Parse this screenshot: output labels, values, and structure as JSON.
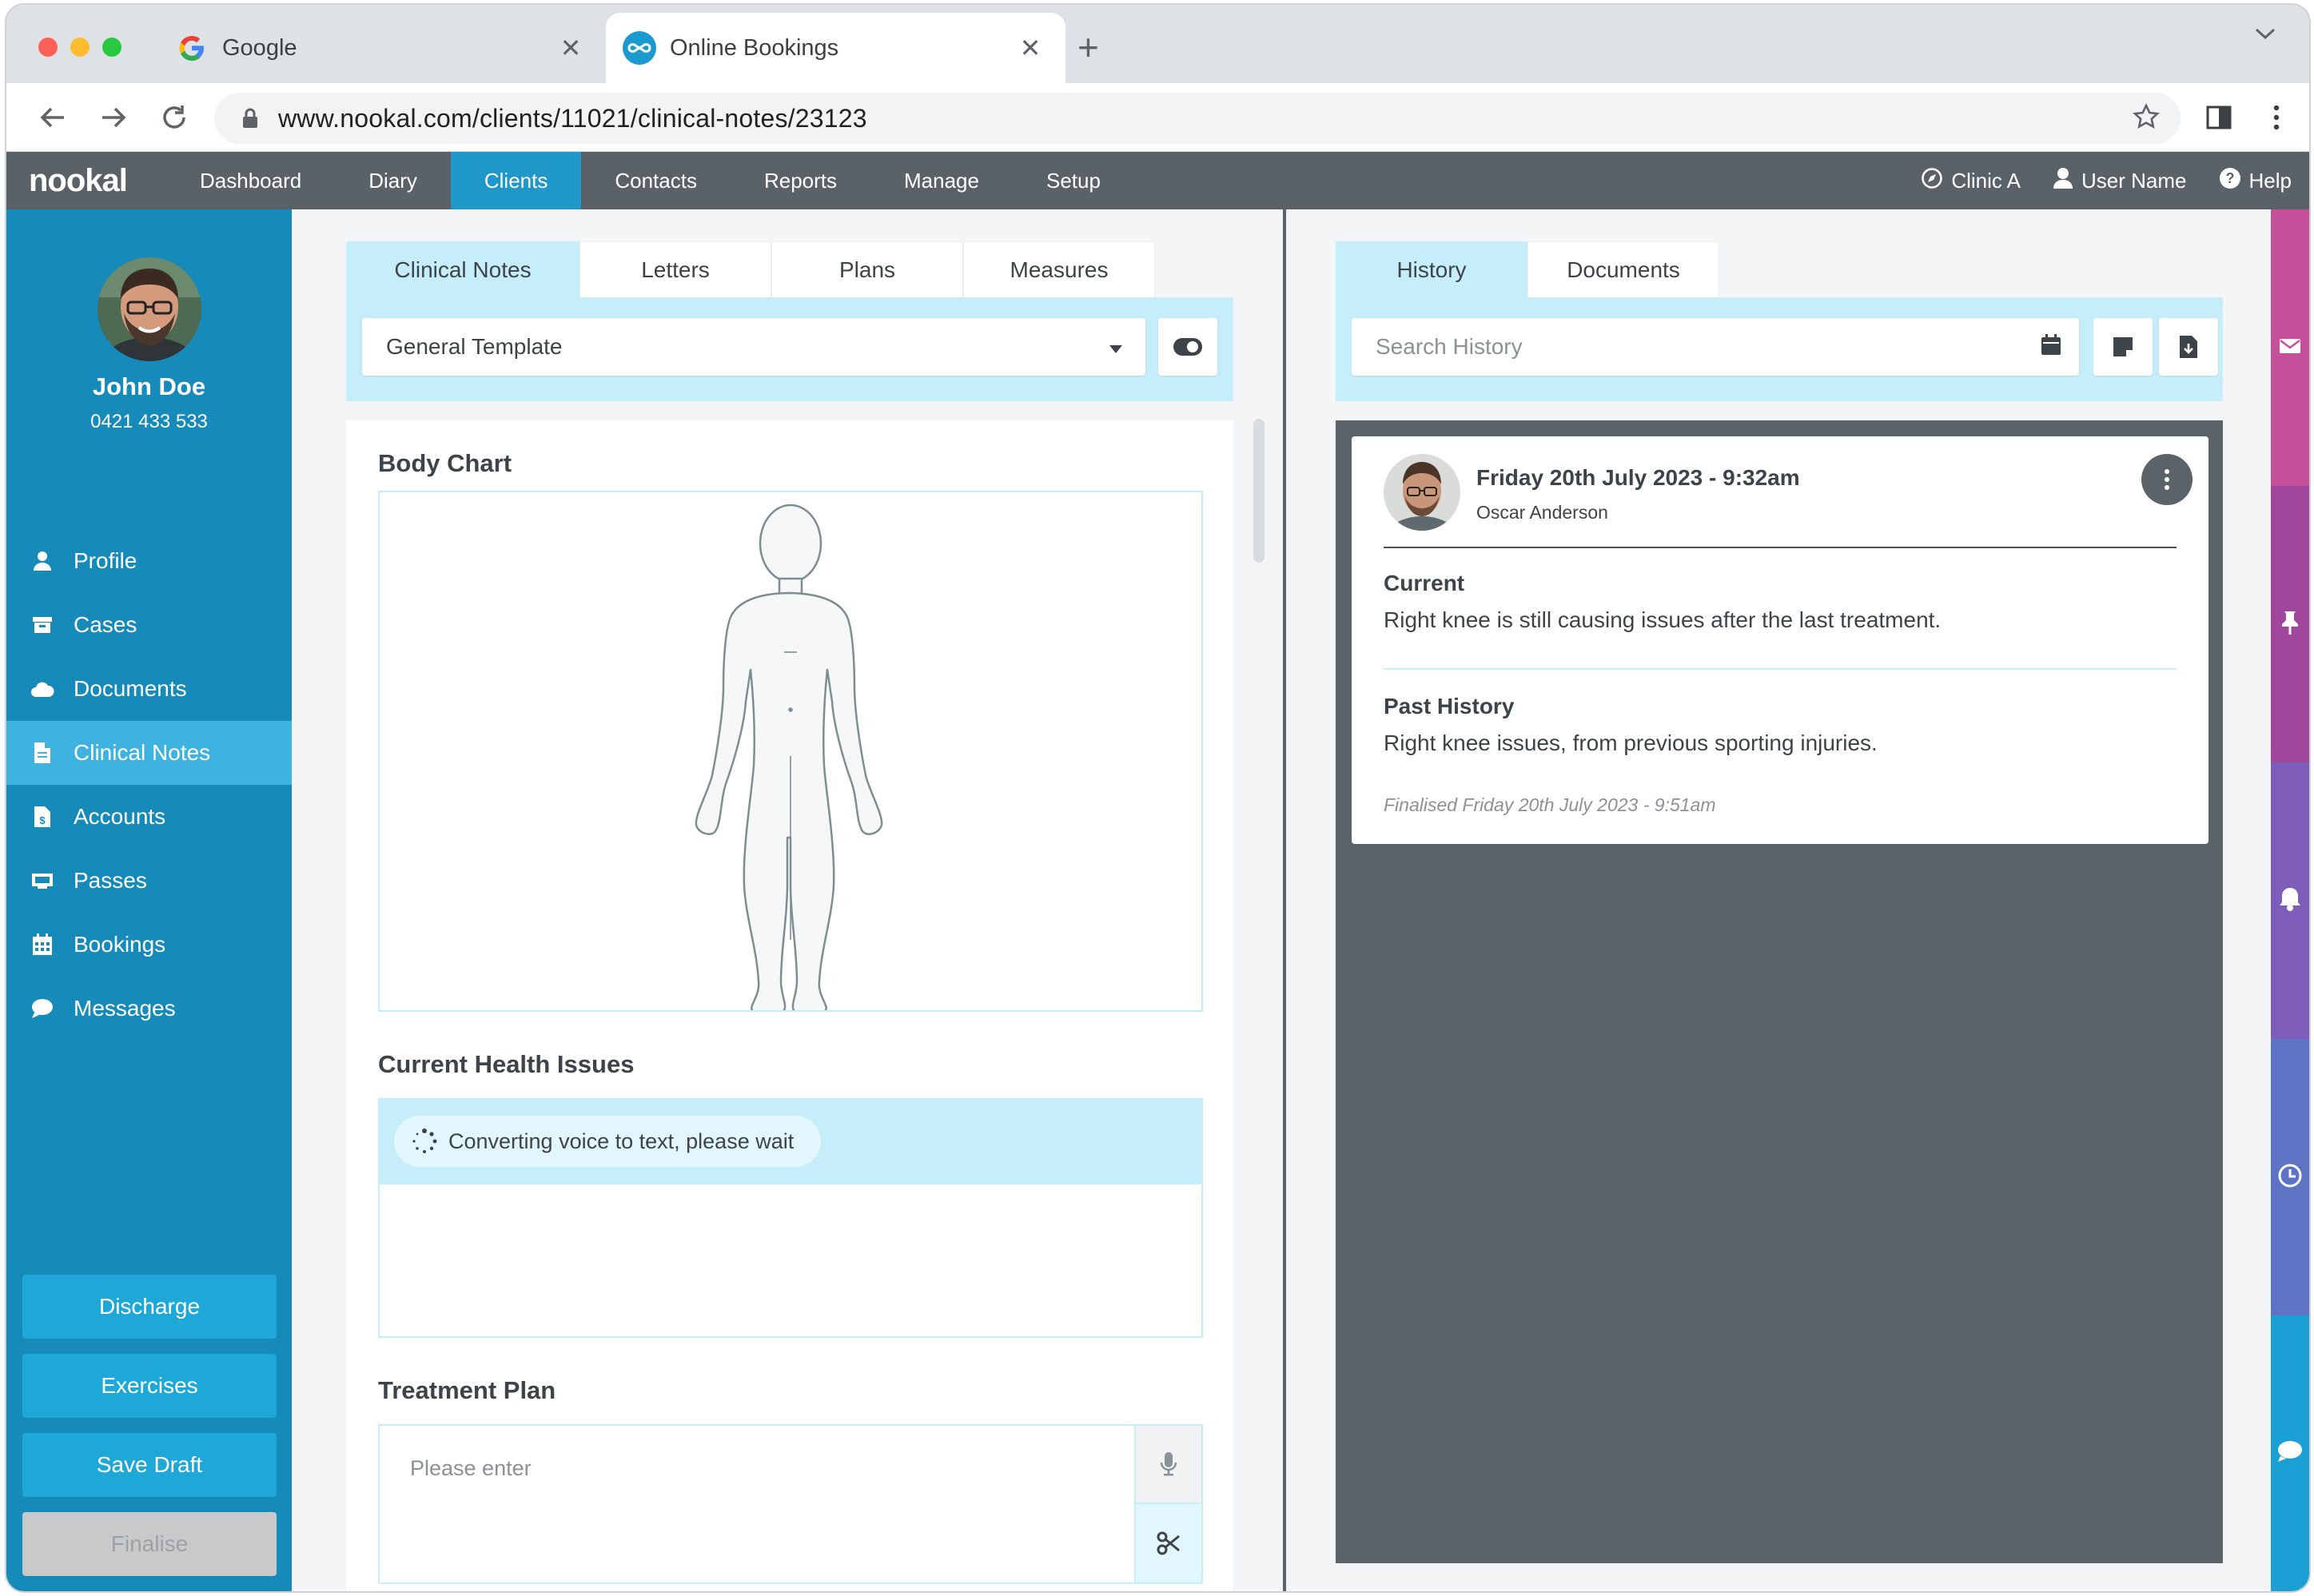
{
  "browser": {
    "tabs": [
      {
        "title": "Google",
        "favicon": "google-g-icon"
      },
      {
        "title": "Online Bookings",
        "favicon": "infinity-logo-icon"
      }
    ],
    "url": "www.nookal.com/clients/11021/clinical-notes/23123"
  },
  "app": {
    "logo": "nookal",
    "nav": [
      "Dashboard",
      "Diary",
      "Clients",
      "Contacts",
      "Reports",
      "Manage",
      "Setup"
    ],
    "active_nav": "Clients",
    "right": {
      "clinic": "Clinic A",
      "user": "User Name",
      "help": "Help"
    },
    "colors": {
      "nav_bg": "#5a6268",
      "accent": "#1f97c9",
      "sidebar": "#168ab9",
      "highlight": "#c6edfa"
    }
  },
  "client": {
    "name": "John Doe",
    "phone": "0421 433 533",
    "menu": [
      {
        "label": "Profile",
        "icon": "user-icon"
      },
      {
        "label": "Cases",
        "icon": "archive-icon"
      },
      {
        "label": "Documents",
        "icon": "cloud-icon"
      },
      {
        "label": "Clinical Notes",
        "icon": "file-icon",
        "active": true
      },
      {
        "label": "Accounts",
        "icon": "invoice-icon"
      },
      {
        "label": "Passes",
        "icon": "pass-icon"
      },
      {
        "label": "Bookings",
        "icon": "calendar-icon"
      },
      {
        "label": "Messages",
        "icon": "chat-icon"
      }
    ],
    "actions": {
      "discharge": "Discharge",
      "exercises": "Exercises",
      "save_draft": "Save Draft",
      "finalise": "Finalise"
    }
  },
  "notes": {
    "tabs": [
      "Clinical Notes",
      "Letters",
      "Plans",
      "Measures"
    ],
    "template": "General Template",
    "sections": {
      "body_chart": "Body Chart",
      "health": "Current Health Issues",
      "converting": "Converting voice to text, please wait",
      "treatment": "Treatment Plan",
      "treatment_placeholder": "Please enter"
    }
  },
  "history": {
    "tabs": [
      "History",
      "Documents"
    ],
    "search_placeholder": "Search History",
    "entry": {
      "date": "Friday 20th July 2023 - 9:32am",
      "author": "Oscar Anderson",
      "current_label": "Current",
      "current_text": "Right knee is still causing issues after the last treatment.",
      "past_label": "Past History",
      "past_text": "Right knee issues, from previous sporting injuries.",
      "finalised": "Finalised Friday 20th July 2023 - 9:51am"
    }
  },
  "rail": [
    {
      "icon": "envelope-icon",
      "color": "#c54f9a"
    },
    {
      "icon": "pin-icon",
      "color": "#a0469c"
    },
    {
      "icon": "bell-icon",
      "color": "#7e5cba"
    },
    {
      "icon": "clock-icon",
      "color": "#5d74c5"
    },
    {
      "icon": "comment-icon",
      "color": "#1aa0d4"
    }
  ]
}
